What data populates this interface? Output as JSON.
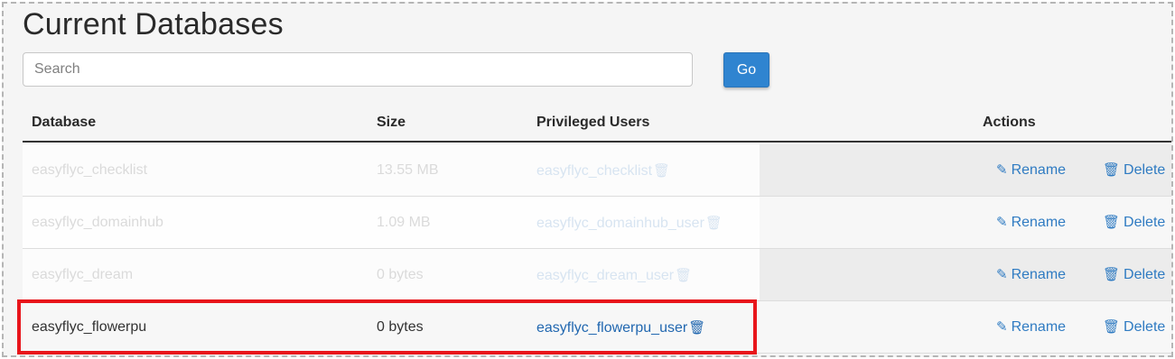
{
  "page": {
    "title": "Current Databases"
  },
  "search": {
    "placeholder": "Search",
    "value": "",
    "go_label": "Go"
  },
  "table": {
    "headers": {
      "database": "Database",
      "size": "Size",
      "users": "Privileged Users",
      "actions": "Actions"
    },
    "rows": [
      {
        "database": "easyflyc_checklist",
        "size": "13.55 MB",
        "user": "easyflyc_checklist",
        "rename": "Rename",
        "delete": "Delete"
      },
      {
        "database": "easyflyc_domainhub",
        "size": "1.09 MB",
        "user": "easyflyc_domainhub_user",
        "rename": "Rename",
        "delete": "Delete"
      },
      {
        "database": "easyflyc_dream",
        "size": "0 bytes",
        "user": "easyflyc_dream_user",
        "rename": "Rename",
        "delete": "Delete"
      },
      {
        "database": "easyflyc_flowerpu",
        "size": "0 bytes",
        "user": "easyflyc_flowerpu_user",
        "rename": "Rename",
        "delete": "Delete"
      }
    ]
  },
  "icons": {
    "edit": "pencil-icon",
    "delete": "trash-icon"
  },
  "colors": {
    "accent": "#2f84d0",
    "link": "#2268b0",
    "highlight": "#e8151b"
  }
}
